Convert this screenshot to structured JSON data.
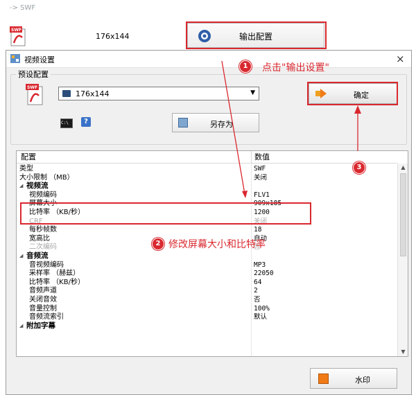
{
  "background": {
    "title": "-> SWF",
    "resolution": "176x144",
    "output_button": "输出配置"
  },
  "dialog": {
    "title": "视频设置",
    "close": "×",
    "preset_group": "预设配置",
    "preset_value": "176x144",
    "save_as": "另存为",
    "ok": "确定",
    "cmd_icon_text": "C:\\",
    "help_icon_text": "?",
    "watermark": "水印"
  },
  "table": {
    "headers": [
      "配置",
      "数值"
    ],
    "rows": [
      {
        "key": "类型",
        "value": "SWF",
        "kind": "top"
      },
      {
        "key": "大小限制 （MB）",
        "value": "关闭",
        "kind": "top"
      },
      {
        "key": "视频流",
        "value": "",
        "kind": "cat"
      },
      {
        "key": "视频编码",
        "value": "FLV1",
        "kind": "sub"
      },
      {
        "key": "屏幕大小",
        "value": "909x185",
        "kind": "sub"
      },
      {
        "key": "比特率 （KB/秒）",
        "value": "1200",
        "kind": "sub"
      },
      {
        "key": "CRF",
        "value": "关闭",
        "kind": "dis"
      },
      {
        "key": "每秒帧数",
        "value": "18",
        "kind": "sub"
      },
      {
        "key": "宽高比",
        "value": "自动",
        "kind": "sub"
      },
      {
        "key": "二次编码",
        "value": "否",
        "kind": "dis"
      },
      {
        "key": "音频流",
        "value": "",
        "kind": "cat"
      },
      {
        "key": "音视频编码",
        "value": "MP3",
        "kind": "sub"
      },
      {
        "key": "采样率 （赫兹）",
        "value": "22050",
        "kind": "sub"
      },
      {
        "key": "比特率 （KB/秒）",
        "value": "64",
        "kind": "sub"
      },
      {
        "key": "音频声道",
        "value": "2",
        "kind": "sub"
      },
      {
        "key": "关闭音效",
        "value": "否",
        "kind": "sub"
      },
      {
        "key": "音量控制",
        "value": "100%",
        "kind": "sub"
      },
      {
        "key": "音频流索引",
        "value": "默认",
        "kind": "sub"
      },
      {
        "key": "附加字幕",
        "value": "",
        "kind": "cat"
      }
    ]
  },
  "annotations": {
    "badge1": "1",
    "badge2": "2",
    "badge3": "3",
    "text1": "点击\"输出设置\"",
    "text2": "修改屏幕大小和比特率"
  },
  "colors": {
    "annotation_red": "#d9282f",
    "accent_orange": "#f07b16"
  }
}
